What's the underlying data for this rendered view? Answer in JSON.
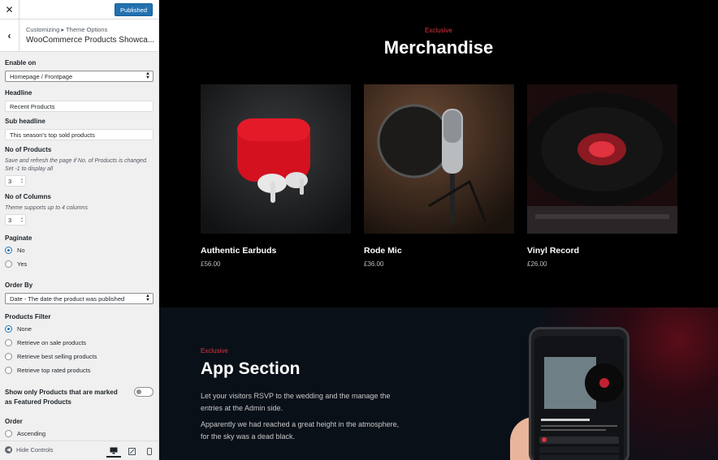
{
  "topbar": {
    "close_icon": "close-icon",
    "publish_label": "Published",
    "publish_color": "#2271b1"
  },
  "section": {
    "breadcrumb": "Customizing ▸ Theme Options",
    "title": "WooCommerce Products Showca..."
  },
  "controls": {
    "enable_on": {
      "label": "Enable on",
      "value": "Homepage / Frontpage"
    },
    "headline": {
      "label": "Headline",
      "value": "Recent Products"
    },
    "sub_headline": {
      "label": "Sub headline",
      "value": "This season's top sold products"
    },
    "no_of_products": {
      "label": "No of Products",
      "description": "Save and refresh the page if No. of Products is changed. Set -1 to display all",
      "value": "3"
    },
    "no_of_columns": {
      "label": "No of Columns",
      "description": "Theme supports up to 4 columns",
      "value": "3"
    },
    "paginate": {
      "label": "Paginate",
      "options": [
        "No",
        "Yes"
      ],
      "selected": "No"
    },
    "order_by": {
      "label": "Order By",
      "value": "Date - The date the product was published"
    },
    "products_filter": {
      "label": "Products Filter",
      "options": [
        "None",
        "Retrieve on sale products",
        "Retrieve best selling products",
        "Retrieve top rated products"
      ],
      "selected": "None"
    },
    "featured_only": {
      "label": "Show only Products that are marked as Featured Products",
      "enabled": false
    },
    "order": {
      "label": "Order",
      "options": [
        "Ascending"
      ]
    }
  },
  "footer": {
    "hide_controls_label": "Hide Controls",
    "devices": [
      "desktop-icon",
      "tablet-icon",
      "mobile-icon"
    ],
    "active_device": "desktop"
  },
  "preview": {
    "merch": {
      "kicker": "Exclusive",
      "title": "Merchandise",
      "products": [
        {
          "name": "Authentic Earbuds",
          "price": "£56.00",
          "image": "earbuds-image"
        },
        {
          "name": "Rode Mic",
          "price": "£36.00",
          "image": "microphone-image"
        },
        {
          "name": "Vinyl Record",
          "price": "£26.00",
          "image": "vinyl-image"
        }
      ]
    },
    "app": {
      "kicker": "Exclusive",
      "title": "App Section",
      "paragraph_1": "Let your visitors RSVP to the wedding and the manage the entries at the Admin side.",
      "paragraph_2": "Apparently we had reached a great height in the atmosphere, for the sky was a dead black."
    }
  },
  "colors": {
    "accent_red": "#e0323f",
    "wp_blue": "#2271b1"
  }
}
